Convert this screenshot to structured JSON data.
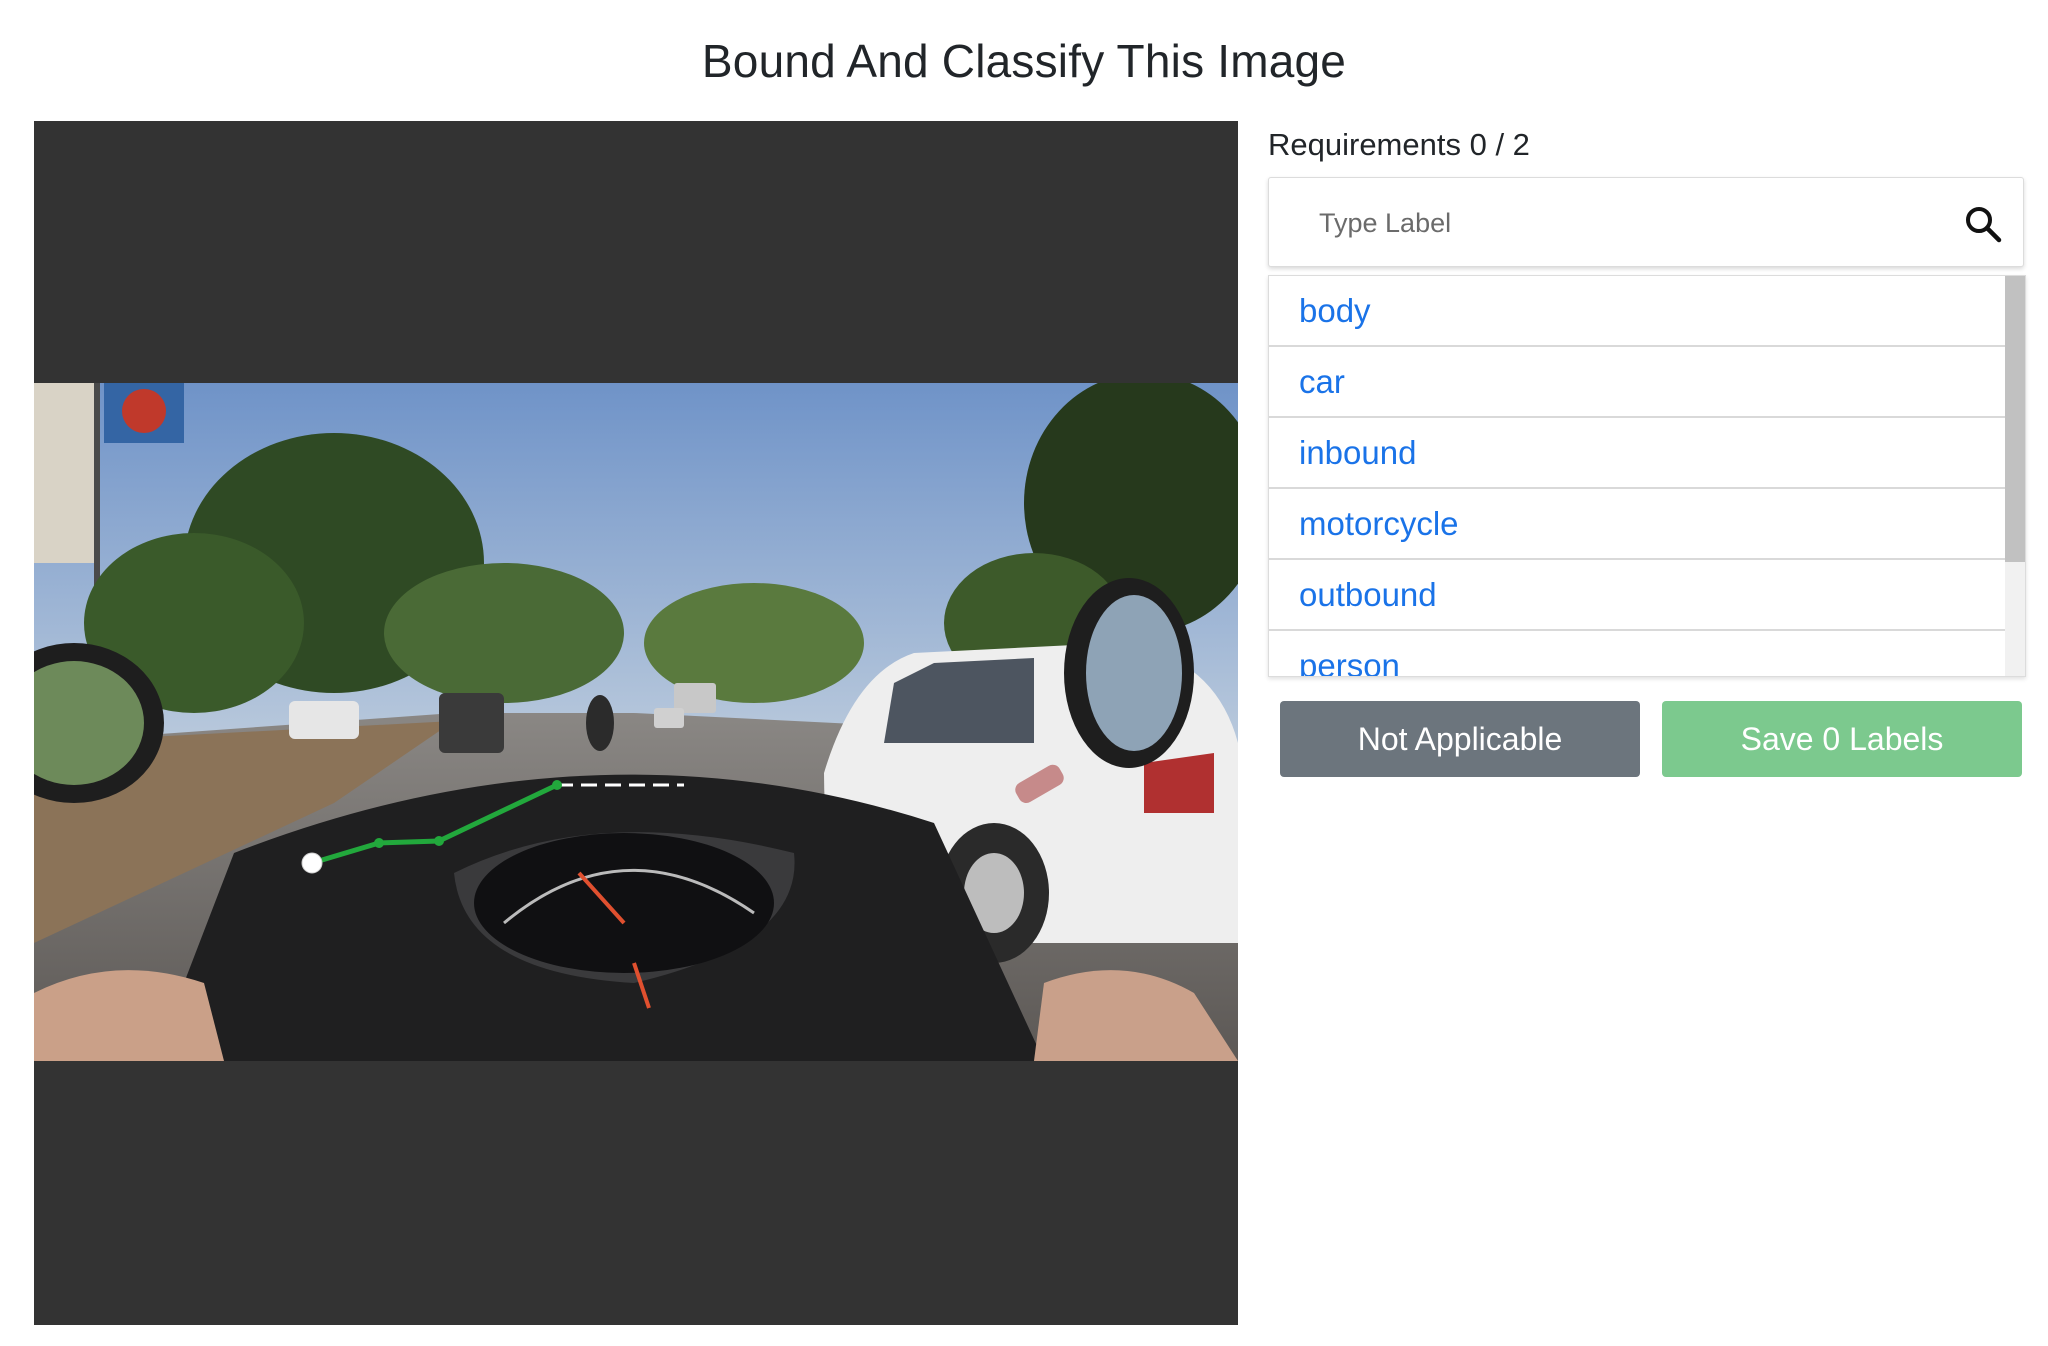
{
  "page": {
    "title": "Bound And Classify This Image"
  },
  "requirements": {
    "text": "Requirements 0 / 2"
  },
  "search": {
    "placeholder": "Type Label",
    "icon": "search-icon"
  },
  "labels": [
    {
      "label": "body"
    },
    {
      "label": "car"
    },
    {
      "label": "inbound"
    },
    {
      "label": "motorcycle"
    },
    {
      "label": "outbound"
    },
    {
      "label": "person"
    }
  ],
  "buttons": {
    "not_applicable": "Not Applicable",
    "save": "Save 0 Labels"
  },
  "colors": {
    "label_link": "#1a73e8",
    "not_applicable_bg": "#6c757d",
    "save_bg": "#7cc98e",
    "canvas_bg": "#333333",
    "polyline": "#22a83c"
  }
}
